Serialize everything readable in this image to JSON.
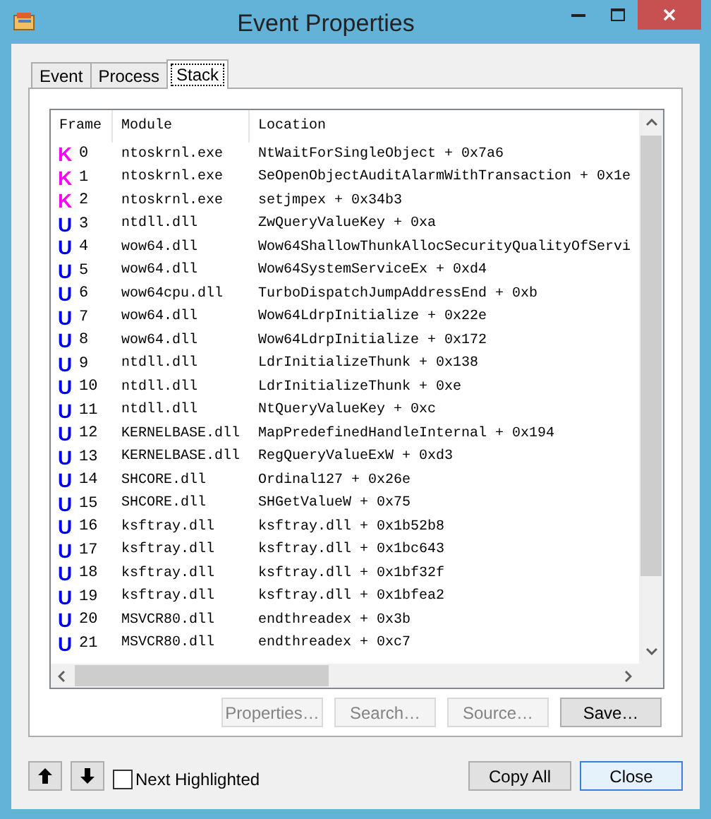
{
  "window": {
    "title": "Event Properties"
  },
  "tabs": [
    {
      "label": "Event",
      "selected": false
    },
    {
      "label": "Process",
      "selected": false
    },
    {
      "label": "Stack",
      "selected": true
    }
  ],
  "stack": {
    "columns": [
      "Frame",
      "Module",
      "Location"
    ],
    "frames": [
      {
        "kind": "kernel",
        "mode": "K",
        "frame": "0",
        "module": "ntoskrnl.exe",
        "location": "NtWaitForSingleObject + 0x7a6"
      },
      {
        "kind": "kernel",
        "mode": "K",
        "frame": "1",
        "module": "ntoskrnl.exe",
        "location": "SeOpenObjectAuditAlarmWithTransaction + 0x1e"
      },
      {
        "kind": "kernel",
        "mode": "K",
        "frame": "2",
        "module": "ntoskrnl.exe",
        "location": "setjmpex + 0x34b3"
      },
      {
        "kind": "user",
        "mode": "U",
        "frame": "3",
        "module": "ntdll.dll",
        "location": "ZwQueryValueKey + 0xa"
      },
      {
        "kind": "user",
        "mode": "U",
        "frame": "4",
        "module": "wow64.dll",
        "location": "Wow64ShallowThunkAllocSecurityQualityOfServi"
      },
      {
        "kind": "user",
        "mode": "U",
        "frame": "5",
        "module": "wow64.dll",
        "location": "Wow64SystemServiceEx + 0xd4"
      },
      {
        "kind": "user",
        "mode": "U",
        "frame": "6",
        "module": "wow64cpu.dll",
        "location": "TurboDispatchJumpAddressEnd + 0xb"
      },
      {
        "kind": "user",
        "mode": "U",
        "frame": "7",
        "module": "wow64.dll",
        "location": "Wow64LdrpInitialize + 0x22e"
      },
      {
        "kind": "user",
        "mode": "U",
        "frame": "8",
        "module": "wow64.dll",
        "location": "Wow64LdrpInitialize + 0x172"
      },
      {
        "kind": "user",
        "mode": "U",
        "frame": "9",
        "module": "ntdll.dll",
        "location": "LdrInitializeThunk + 0x138"
      },
      {
        "kind": "user",
        "mode": "U",
        "frame": "10",
        "module": "ntdll.dll",
        "location": "LdrInitializeThunk + 0xe"
      },
      {
        "kind": "user",
        "mode": "U",
        "frame": "11",
        "module": "ntdll.dll",
        "location": "NtQueryValueKey + 0xc"
      },
      {
        "kind": "user",
        "mode": "U",
        "frame": "12",
        "module": "KERNELBASE.dll",
        "location": "MapPredefinedHandleInternal + 0x194"
      },
      {
        "kind": "user",
        "mode": "U",
        "frame": "13",
        "module": "KERNELBASE.dll",
        "location": "RegQueryValueExW + 0xd3"
      },
      {
        "kind": "user",
        "mode": "U",
        "frame": "14",
        "module": "SHCORE.dll",
        "location": "Ordinal127 + 0x26e"
      },
      {
        "kind": "user",
        "mode": "U",
        "frame": "15",
        "module": "SHCORE.dll",
        "location": "SHGetValueW + 0x75"
      },
      {
        "kind": "user",
        "mode": "U",
        "frame": "16",
        "module": "ksftray.dll",
        "location": "ksftray.dll + 0x1b52b8"
      },
      {
        "kind": "user",
        "mode": "U",
        "frame": "17",
        "module": "ksftray.dll",
        "location": "ksftray.dll + 0x1bc643"
      },
      {
        "kind": "user",
        "mode": "U",
        "frame": "18",
        "module": "ksftray.dll",
        "location": "ksftray.dll + 0x1bf32f"
      },
      {
        "kind": "user",
        "mode": "U",
        "frame": "19",
        "module": "ksftray.dll",
        "location": "ksftray.dll + 0x1bfea2"
      },
      {
        "kind": "user",
        "mode": "U",
        "frame": "20",
        "module": "MSVCR80.dll",
        "location": "endthreadex + 0x3b"
      },
      {
        "kind": "user",
        "mode": "U",
        "frame": "21",
        "module": "MSVCR80.dll",
        "location": "endthreadex + 0xc7"
      }
    ]
  },
  "panel_buttons": [
    {
      "label": "Properties…",
      "disabled": true
    },
    {
      "label": "Search…",
      "disabled": true
    },
    {
      "label": "Source…",
      "disabled": true
    },
    {
      "label": "Save…",
      "disabled": false
    }
  ],
  "next_highlighted": {
    "label": "Next Highlighted",
    "checked": false
  },
  "dialog_buttons": [
    {
      "label": "Copy All",
      "default": false
    },
    {
      "label": "Close",
      "default": true
    }
  ]
}
